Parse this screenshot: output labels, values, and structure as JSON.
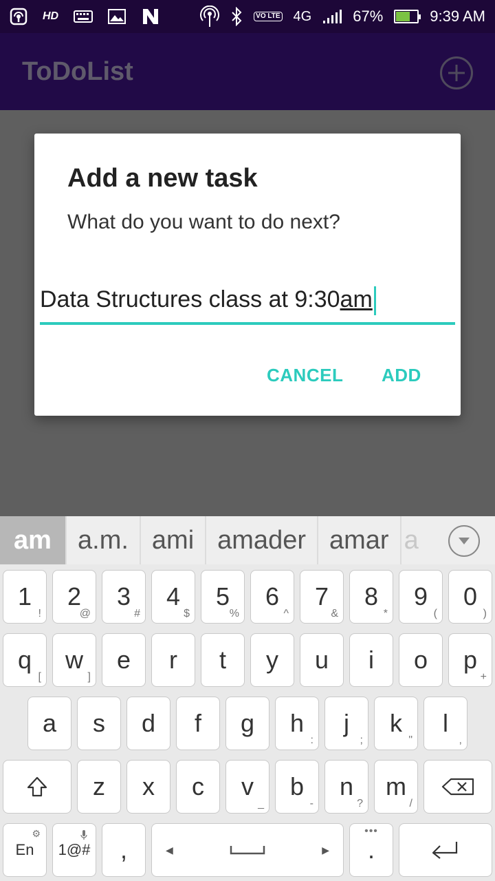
{
  "status_bar": {
    "hd": "HD",
    "network": "4G",
    "volte": "VO LTE",
    "battery_percent": "67%",
    "battery_level": 0.67,
    "time": "9:39 AM"
  },
  "app": {
    "title": "ToDoList"
  },
  "dialog": {
    "title": "Add a new task",
    "message": "What do you want to do next?",
    "input_typed": "Data Structures class at 9:30",
    "input_composing": "am",
    "cancel_label": "CANCEL",
    "add_label": "ADD"
  },
  "keyboard": {
    "suggestions": [
      "am",
      "a.m.",
      "ami",
      "amader",
      "amar",
      "a"
    ],
    "row_numbers": [
      {
        "k": "1",
        "s": "!"
      },
      {
        "k": "2",
        "s": "@"
      },
      {
        "k": "3",
        "s": "#"
      },
      {
        "k": "4",
        "s": "$"
      },
      {
        "k": "5",
        "s": "%"
      },
      {
        "k": "6",
        "s": "^"
      },
      {
        "k": "7",
        "s": "&"
      },
      {
        "k": "8",
        "s": "*"
      },
      {
        "k": "9",
        "s": "("
      },
      {
        "k": "0",
        "s": ")"
      }
    ],
    "row_q": [
      {
        "k": "q",
        "s": "["
      },
      {
        "k": "w",
        "s": "]"
      },
      {
        "k": "e",
        "s": ""
      },
      {
        "k": "r",
        "s": ""
      },
      {
        "k": "t",
        "s": ""
      },
      {
        "k": "y",
        "s": ""
      },
      {
        "k": "u",
        "s": ""
      },
      {
        "k": "i",
        "s": ""
      },
      {
        "k": "o",
        "s": ""
      },
      {
        "k": "p",
        "s": "+"
      }
    ],
    "row_a": [
      {
        "k": "a",
        "s": ""
      },
      {
        "k": "s",
        "s": ""
      },
      {
        "k": "d",
        "s": ""
      },
      {
        "k": "f",
        "s": ""
      },
      {
        "k": "g",
        "s": ""
      },
      {
        "k": "h",
        "s": ":"
      },
      {
        "k": "j",
        "s": ";"
      },
      {
        "k": "k",
        "s": "\""
      },
      {
        "k": "l",
        "s": ","
      }
    ],
    "row_z": [
      {
        "k": "z",
        "s": ""
      },
      {
        "k": "x",
        "s": ""
      },
      {
        "k": "c",
        "s": ""
      },
      {
        "k": "v",
        "s": "_"
      },
      {
        "k": "b",
        "s": "-"
      },
      {
        "k": "n",
        "s": "?"
      },
      {
        "k": "m",
        "s": "/"
      }
    ],
    "lang_label": "En",
    "symbols_label": "1@#",
    "comma_label": ",",
    "period_label": "."
  }
}
